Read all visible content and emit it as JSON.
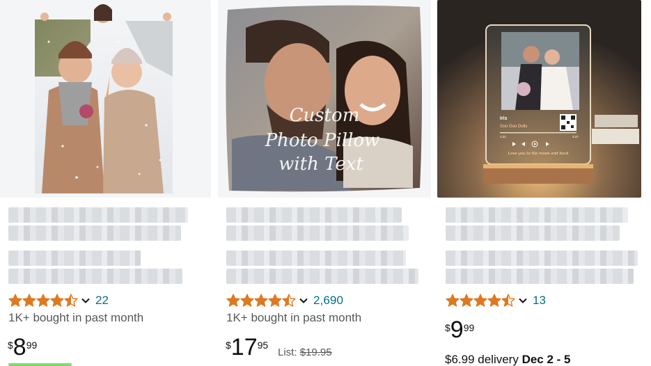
{
  "products": [
    {
      "image_alt": "blanket",
      "rating": {
        "stars": 4.5,
        "count": "22"
      },
      "bought": "1K+ bought in past month",
      "price": {
        "currency": "$",
        "whole": "8",
        "cents": "99"
      }
    },
    {
      "image_alt": "pillow",
      "pillow_text": [
        "Custom",
        "Photo Pillow",
        "with Text"
      ],
      "rating": {
        "stars": 4.5,
        "count": "2,690"
      },
      "bought": "1K+ bought in past month",
      "price": {
        "currency": "$",
        "whole": "17",
        "cents": "95"
      },
      "list_label": "List:",
      "list_price": "$19.95"
    },
    {
      "image_alt": "plaque",
      "plaque": {
        "song": "Iris",
        "artist": "Goo Goo Dolls",
        "t_start": "1:21",
        "t_end": "3:37",
        "caption": "Love you to the moon and back"
      },
      "rating": {
        "stars": 4.5,
        "count": "13"
      },
      "price": {
        "currency": "$",
        "whole": "9",
        "cents": "99"
      },
      "delivery": {
        "prefix": "$6.99 delivery",
        "dates": "Dec 2 - 5"
      }
    }
  ],
  "colors": {
    "star": "#de7921",
    "link": "#007185",
    "muted": "#565959",
    "text": "#0f1111",
    "badge_green": "#7fda69"
  }
}
